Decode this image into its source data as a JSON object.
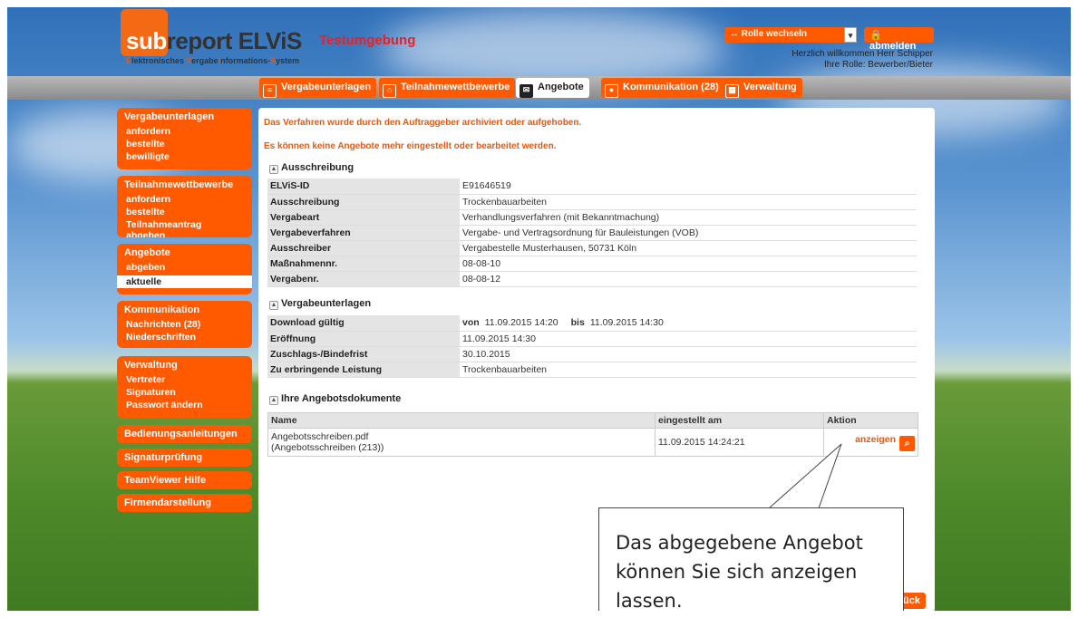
{
  "header": {
    "logo_sub": "sub",
    "logo_report": "report",
    "logo_elvis": "ELViS",
    "tagline_parts": [
      "E",
      "lektronisches ",
      "V",
      "ergabe",
      "i",
      "nformations-",
      "S",
      "ystem"
    ],
    "environment": "Testumgebung",
    "role_switch": "↔ Rolle wechseln",
    "logout": "abmelden",
    "welcome": "Herzlich willkommen Herr Schipper",
    "role": "Ihre Rolle: Bewerber/Bieter"
  },
  "nav": [
    {
      "label": "Vergabeunterlagen",
      "icon": "document-icon"
    },
    {
      "label": "Teilnahmewettbewerbe",
      "icon": "door-icon"
    },
    {
      "label": "Angebote",
      "icon": "envelope-icon"
    },
    {
      "label": "Kommunikation (28)",
      "icon": "user-icon"
    },
    {
      "label": "Verwaltung",
      "icon": "building-icon"
    }
  ],
  "sidebar": [
    {
      "title": "Vergabeunterlagen",
      "links": [
        "anfordern",
        "bestellte",
        "bewilligte"
      ]
    },
    {
      "title": "Teilnahmewettbewerbe",
      "links": [
        "anfordern",
        "bestellte",
        "Teilnahmeantrag abgeben"
      ]
    },
    {
      "title": "Angebote",
      "links": [
        "abgeben",
        "aktuelle"
      ]
    },
    {
      "title": "Kommunikation",
      "links": [
        "Nachrichten (28)",
        "Niederschriften"
      ]
    },
    {
      "title": "Verwaltung",
      "links": [
        "Vertreter",
        "Signaturen",
        "Passwort ändern"
      ]
    },
    {
      "title": "Bedienungsanleitungen",
      "links": []
    },
    {
      "title": "Signaturprüfung",
      "links": []
    },
    {
      "title": "TeamViewer Hilfe",
      "links": []
    },
    {
      "title": "Firmendarstellung",
      "links": []
    }
  ],
  "main": {
    "warning1": "Das Verfahren wurde durch den Auftraggeber archiviert oder aufgehoben.",
    "warning2": "Es können keine Angebote mehr eingestellt oder bearbeitet werden.",
    "section_ausschreibung": "Ausschreibung",
    "ausschreibung": [
      {
        "k": "ELViS-ID",
        "v": "E91646519"
      },
      {
        "k": "Ausschreibung",
        "v": "Trockenbauarbeiten"
      },
      {
        "k": "Vergabeart",
        "v": "Verhandlungsverfahren (mit Bekanntmachung)"
      },
      {
        "k": "Vergabeverfahren",
        "v": "Vergabe- und Vertragsordnung für Bauleistungen (VOB)"
      },
      {
        "k": "Ausschreiber",
        "v": "Vergabestelle Musterhausen, 50731 Köln"
      },
      {
        "k": "Maßnahmennr.",
        "v": "08-08-10"
      },
      {
        "k": "Vergabenr.",
        "v": "08-08-12"
      }
    ],
    "section_vergabeunterlagen": "Vergabeunterlagen",
    "download": {
      "k": "Download gültig",
      "von_label": "von",
      "von": "11.09.2015 14:20",
      "bis_label": "bis",
      "bis": "11.09.2015 14:30"
    },
    "vergabeunterlagen": [
      {
        "k": "Eröffnung",
        "v": "11.09.2015 14:30"
      },
      {
        "k": "Zuschlags-/Bindefrist",
        "v": "30.10.2015"
      },
      {
        "k": "Zu erbringende Leistung",
        "v": "Trockenbauarbeiten"
      }
    ],
    "section_dokumente": "Ihre Angebotsdokumente",
    "doc_headers": [
      "Name",
      "eingestellt am",
      "Aktion"
    ],
    "doc_rows": [
      {
        "name": "Angebotsschreiben.pdf",
        "sub": "(Angebotsschreiben (213))",
        "date": "11.09.2015 14:24:21",
        "action": "anzeigen"
      }
    ],
    "back": "ück"
  },
  "callout": {
    "text": "Das abgegebene Angebot können Sie sich anzeigen lassen."
  }
}
